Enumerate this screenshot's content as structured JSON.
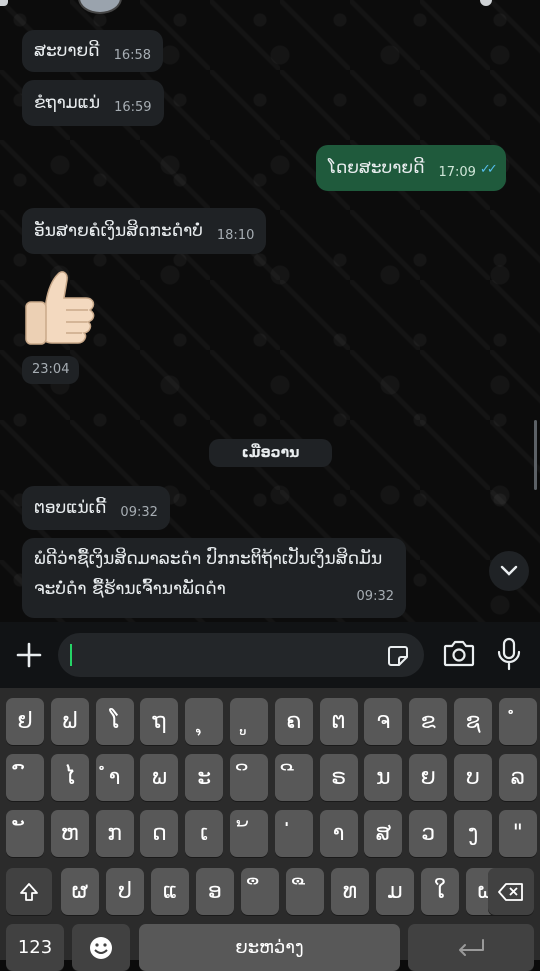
{
  "messages": [
    {
      "text": "ສະບາຍດີ",
      "time": "16:58",
      "dir": "in"
    },
    {
      "text": "ຂໍຖາມແນ່",
      "time": "16:59",
      "dir": "in"
    },
    {
      "text": "ໂດຍສະບາຍດີ",
      "time": "17:09",
      "dir": "out"
    },
    {
      "text": "ອັນສາຍຄໍເງິນສິດກະດໍາບໍ່",
      "time": "18:10",
      "dir": "in"
    }
  ],
  "emoji_message": {
    "emoji": "👍",
    "time": "23:04"
  },
  "date_divider": "ເມື່ອວານ",
  "messages_after": [
    {
      "text": "ຕອບແນ່ເດີ້",
      "time": "09:32"
    }
  ],
  "long_message": {
    "line1": "ພໍດີວ່າຊື້ເງິນສິດມາລະດໍາ ປົກກະຕິຖ້າເປັນເງິນສິດມັນ",
    "line2": "ຈະບໍ່ດໍາ ຊື້ຮ້ານເຈົ້ານາພັດດໍາ",
    "time": "09:32"
  },
  "read_ticks": "✓✓",
  "keyboard": {
    "row1": [
      "ຢ",
      "ຟ",
      "ໂ",
      "ຖ",
      "ຸ",
      "ູ",
      "ຄ",
      "ຕ",
      "ຈ",
      "ຂ",
      "ຊ",
      "ໍ"
    ],
    "row2": [
      "ົ",
      "ໄ",
      "ຳ",
      "ພ",
      "ະ",
      "ິ",
      "ີ",
      "ຣ",
      "ນ",
      "ຍ",
      "ບ",
      "ລ"
    ],
    "row3": [
      "ັ",
      "ຫ",
      "ກ",
      "ດ",
      "ເ",
      "້",
      "່",
      "າ",
      "ສ",
      "ວ",
      "ງ",
      "\""
    ],
    "row4": [
      "ຜ",
      "ປ",
      "ແ",
      "ອ",
      "ຶ",
      "ື",
      "ທ",
      "ມ",
      "ໃ",
      "ຝ"
    ],
    "num_key": "123",
    "space_label": "ຍະຫວ່າງ"
  },
  "colors": {
    "incoming_bubble": "#1f2225",
    "outgoing_bubble": "#1f5a3c",
    "read_tick": "#53bdeb",
    "accent": "#25d366"
  }
}
